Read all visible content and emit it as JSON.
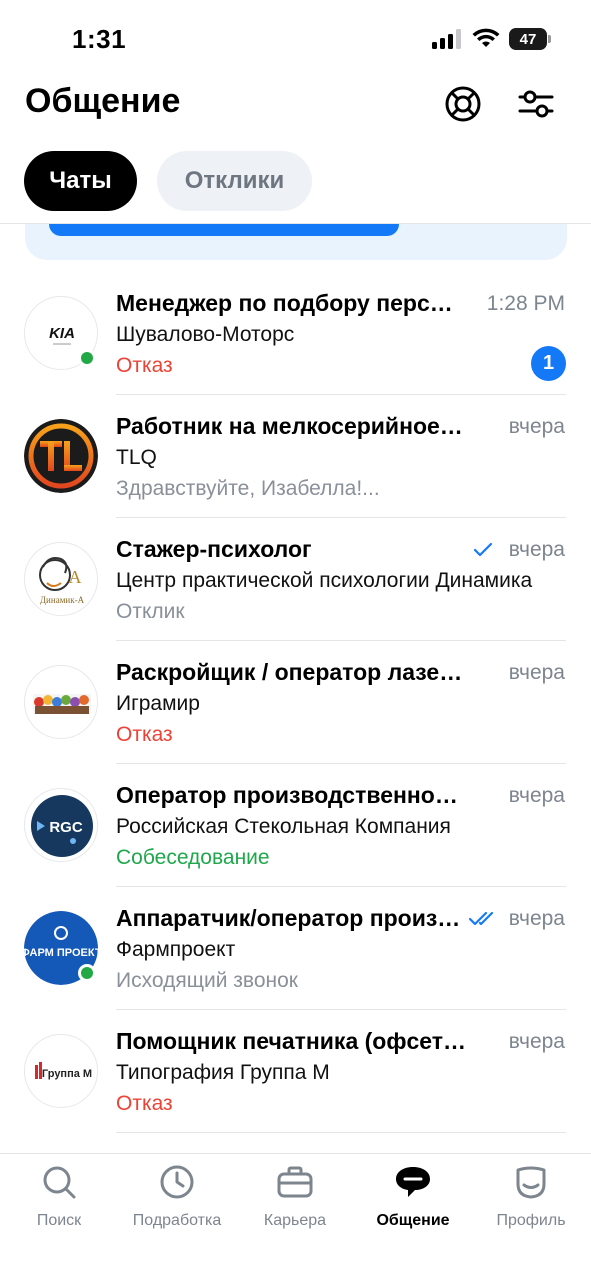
{
  "status_bar": {
    "time": "1:31",
    "battery": "47"
  },
  "header": {
    "title": "Общение"
  },
  "tabs": [
    {
      "label": "Чаты",
      "active": true
    },
    {
      "label": "Отклики",
      "active": false
    }
  ],
  "chats": [
    {
      "title": "Менеджер по подбору персонала",
      "company": "Шувалово-Моторс",
      "status": "Отказ",
      "status_type": "red",
      "time": "1:28 PM",
      "unread": "1",
      "online": true,
      "avatar": "kia-logo",
      "check": "none"
    },
    {
      "title": "Работник на мелкосерийное производство",
      "company": "TLQ",
      "status": "Здравствуйте, Изабелла!...",
      "status_type": "gray",
      "time": "вчера",
      "online": false,
      "avatar": "tlq-logo",
      "check": "none"
    },
    {
      "title": "Стажер-психолог",
      "company": "Центр практической психологии Динамика",
      "status": "Отклик",
      "status_type": "gray",
      "time": "вчера",
      "online": false,
      "avatar": "dinamika-logo",
      "avatar_text": "Динамик-А",
      "check": "single"
    },
    {
      "title": "Раскройщик / оператор лазерного станка",
      "company": "Играмир",
      "status": "Отказ",
      "status_type": "red",
      "time": "вчера",
      "online": false,
      "avatar": "igramir-logo",
      "check": "none"
    },
    {
      "title": "Оператор производственной линии",
      "company": "Российская Стекольная Компания",
      "status": "Собеседование",
      "status_type": "green",
      "time": "вчера",
      "online": false,
      "avatar": "rgc-logo",
      "avatar_text": "RGC",
      "check": "none"
    },
    {
      "title": "Аппаратчик/оператор производства",
      "company": "Фармпроект",
      "status": "Исходящий звонок",
      "status_type": "gray",
      "time": "вчера",
      "online": true,
      "avatar": "farmproekt-logo",
      "avatar_text": "ФАРМ ПРОЕКТ",
      "check": "double"
    },
    {
      "title": "Помощник печатника (офсетная печать)",
      "company": "Типография Группа М",
      "status": "Отказ",
      "status_type": "red",
      "time": "вчера",
      "online": false,
      "avatar": "gruppa-m-logo",
      "avatar_text": "Группа М",
      "check": "none"
    }
  ],
  "bottom_nav": [
    {
      "label": "Поиск",
      "icon": "search-icon",
      "active": false
    },
    {
      "label": "Подработка",
      "icon": "clock-icon",
      "active": false
    },
    {
      "label": "Карьера",
      "icon": "briefcase-icon",
      "active": false
    },
    {
      "label": "Общение",
      "icon": "chat-bubble-icon",
      "active": true
    },
    {
      "label": "Профиль",
      "icon": "profile-icon",
      "active": false
    }
  ],
  "colors": {
    "accent": "#1479f7",
    "refusal": "#eb4335",
    "interview": "#1fa84b",
    "muted": "#7d858f"
  }
}
